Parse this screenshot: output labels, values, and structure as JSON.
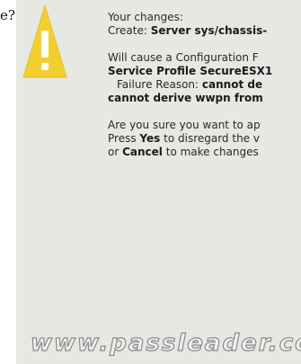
{
  "leading_char": "e?",
  "dialog": {
    "changes_heading": "Your changes:",
    "create_prefix": "Create:",
    "create_target": "Server sys/chassis-",
    "will_cause": "Will cause a Configuration F",
    "service_profile": "Service Profile SecureESX1",
    "failure_reason_label": "Failure Reason:",
    "failure_reason_value": "cannot de",
    "wwpn_error": "cannot derive wwpn from",
    "confirm_question": "Are you sure you want to ap",
    "press_prefix": "Press",
    "yes_label": "Yes",
    "press_suffix": "to disregard the v",
    "or_prefix": "or",
    "cancel_label": "Cancel",
    "cancel_suffix": "to make changes"
  },
  "watermark": "www.passleader.co",
  "colors": {
    "dialog_bg": "#e6e8e4",
    "warning_yellow": "#f3cf2e"
  },
  "icons": [
    "warning-icon"
  ]
}
